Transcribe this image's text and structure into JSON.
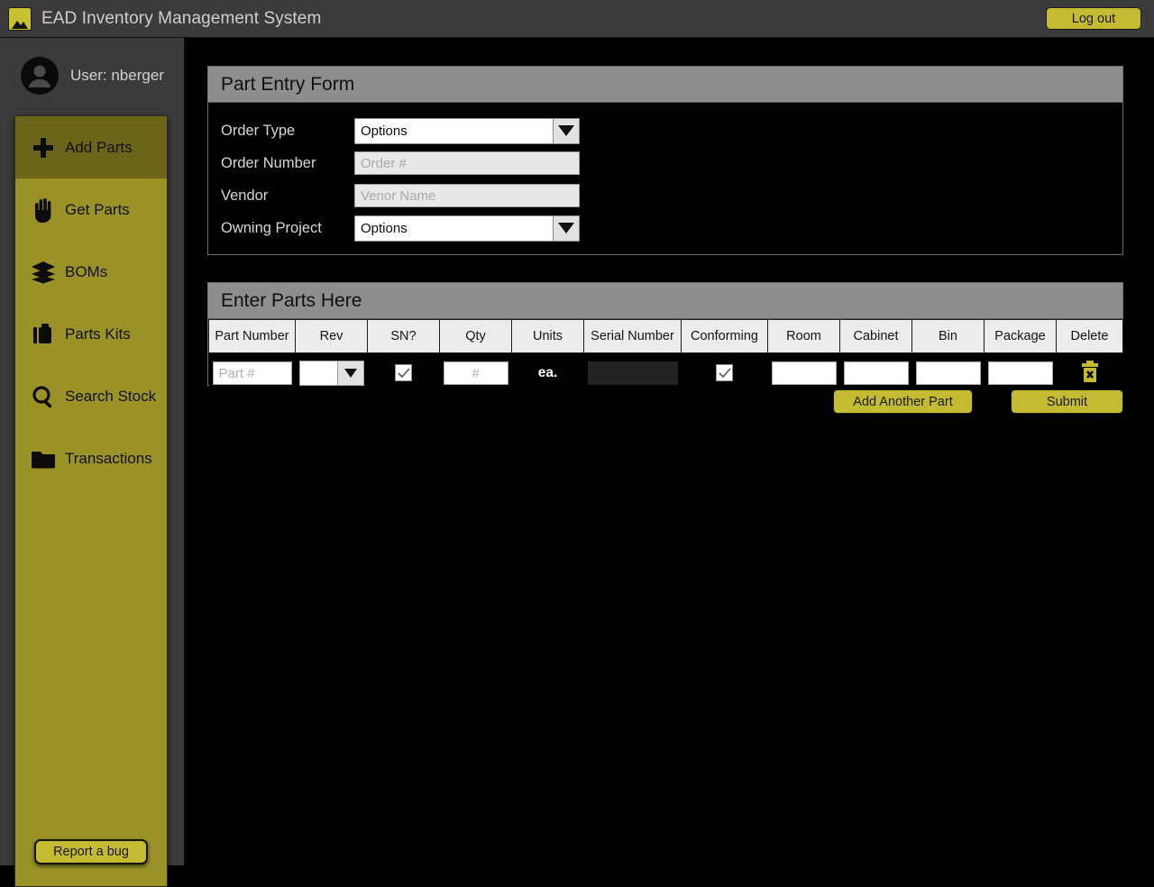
{
  "titlebar": {
    "app_title": "EAD Inventory Management System",
    "logo_icon": "mountain-image-icon",
    "logout_label": "Log out"
  },
  "sidebar": {
    "user_label": "User: nberger",
    "avatar_icon": "user-avatar-icon",
    "items": [
      {
        "label": "Add Parts",
        "icon": "plus-icon",
        "active": true
      },
      {
        "label": "Get Parts",
        "icon": "hand-icon",
        "active": false
      },
      {
        "label": "BOMs",
        "icon": "layers-icon",
        "active": false
      },
      {
        "label": "Parts Kits",
        "icon": "briefcase-icon",
        "active": false
      },
      {
        "label": "Search Stock",
        "icon": "magnifier-icon",
        "active": false
      },
      {
        "label": "Transactions",
        "icon": "folder-icon",
        "active": false
      }
    ],
    "report_bug_label": "Report a bug"
  },
  "part_entry_form": {
    "title": "Part Entry Form",
    "fields": [
      {
        "label": "Order Type",
        "type": "select",
        "value": "Options"
      },
      {
        "label": "Order Number",
        "type": "text",
        "value": "",
        "placeholder": "Order #"
      },
      {
        "label": "Vendor",
        "type": "text",
        "value": "",
        "placeholder": "Venor Name"
      },
      {
        "label": "Owning Project",
        "type": "select",
        "value": "Options"
      }
    ]
  },
  "parts_table": {
    "title": "Enter Parts Here",
    "columns": [
      "Part Number",
      "Rev",
      "SN?",
      "Qty",
      "Units",
      "Serial Number",
      "Conforming",
      "Room",
      "Cabinet",
      "Bin",
      "Package",
      "Delete"
    ],
    "rows": [
      {
        "part_number": "",
        "part_number_placeholder": "Part #",
        "rev": "",
        "sn_checked": true,
        "qty": "",
        "qty_placeholder": "#",
        "units": "ea.",
        "serial_number": "",
        "serial_number_disabled": true,
        "conforming_checked": true,
        "room": "",
        "cabinet": "",
        "bin": "",
        "package": "",
        "delete_icon": "trash-delete-icon"
      }
    ]
  },
  "actions": {
    "add_another_part_label": "Add Another Part",
    "submit_label": "Submit"
  },
  "colors": {
    "accent_yellow": "#c5bb33",
    "sidebar_olive": "#9a9226",
    "sidebar_olive_active": "#6b6519",
    "chrome_gray": "#3b3b3b",
    "card_header_gray": "#8e8e8e",
    "background_black": "#000000"
  }
}
